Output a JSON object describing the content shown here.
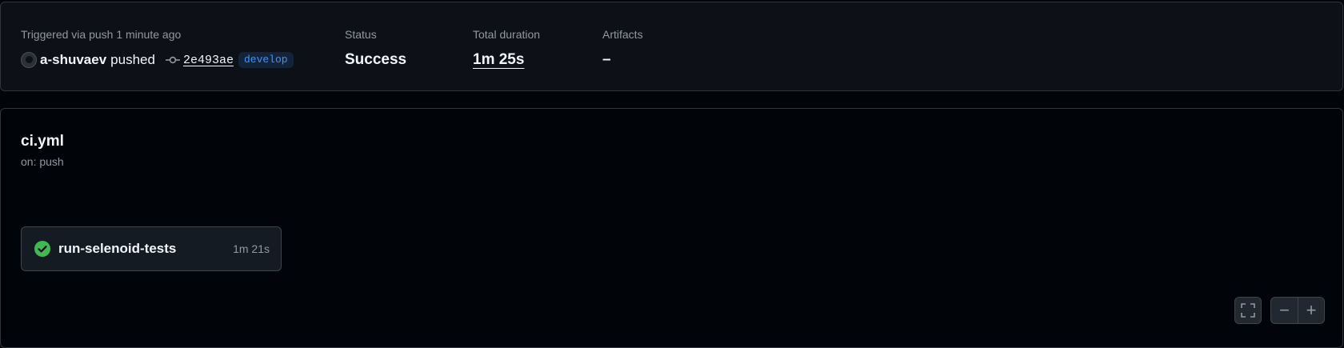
{
  "summary": {
    "trigger_label": "Triggered via push 1 minute ago",
    "actor": "a-shuvaev",
    "action": "pushed",
    "commit_sha": "2e493ae",
    "branch": "develop",
    "status_label": "Status",
    "status_value": "Success",
    "duration_label": "Total duration",
    "duration_value": "1m 25s",
    "artifacts_label": "Artifacts",
    "artifacts_value": "–"
  },
  "workflow": {
    "name": "ci.yml",
    "trigger": "on: push"
  },
  "jobs": [
    {
      "name": "run-selenoid-tests",
      "duration": "1m 21s",
      "status": "success"
    }
  ],
  "controls": {
    "zoom_out": "−",
    "zoom_in": "+"
  },
  "icons": {
    "commit": "git-commit-icon",
    "check": "check-circle-fill-icon",
    "fullscreen": "fullscreen-icon"
  },
  "colors": {
    "success": "#3fb950",
    "branch_text": "#4493f8",
    "background": "#010409",
    "panel": "#0d1117"
  }
}
